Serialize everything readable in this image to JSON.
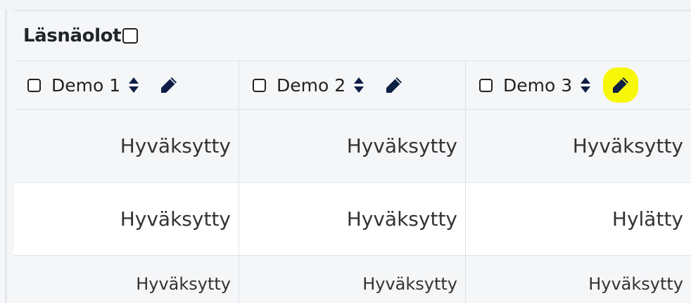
{
  "table": {
    "section_title": "Läsnäolot",
    "columns": [
      {
        "label": "Demo 1"
      },
      {
        "label": "Demo 2"
      },
      {
        "label": "Demo 3"
      }
    ],
    "rows": [
      {
        "cells": [
          "Hyväksytty",
          "Hyväksytty",
          "Hyväksytty"
        ]
      },
      {
        "cells": [
          "Hyväksytty",
          "Hyväksytty",
          "Hylätty"
        ]
      },
      {
        "cells": [
          "Hyväksytty",
          "Hyväksytty",
          "Hyväksytty"
        ]
      }
    ]
  },
  "icons": {
    "sort": "sort-icon",
    "edit": "pencil-edit-icon",
    "checkbox": "checkbox-icon"
  },
  "colors": {
    "icon": "#0d1f44",
    "highlight": "#f7f70a",
    "header_background": "#f5f6f8",
    "border": "#dee2e6"
  }
}
